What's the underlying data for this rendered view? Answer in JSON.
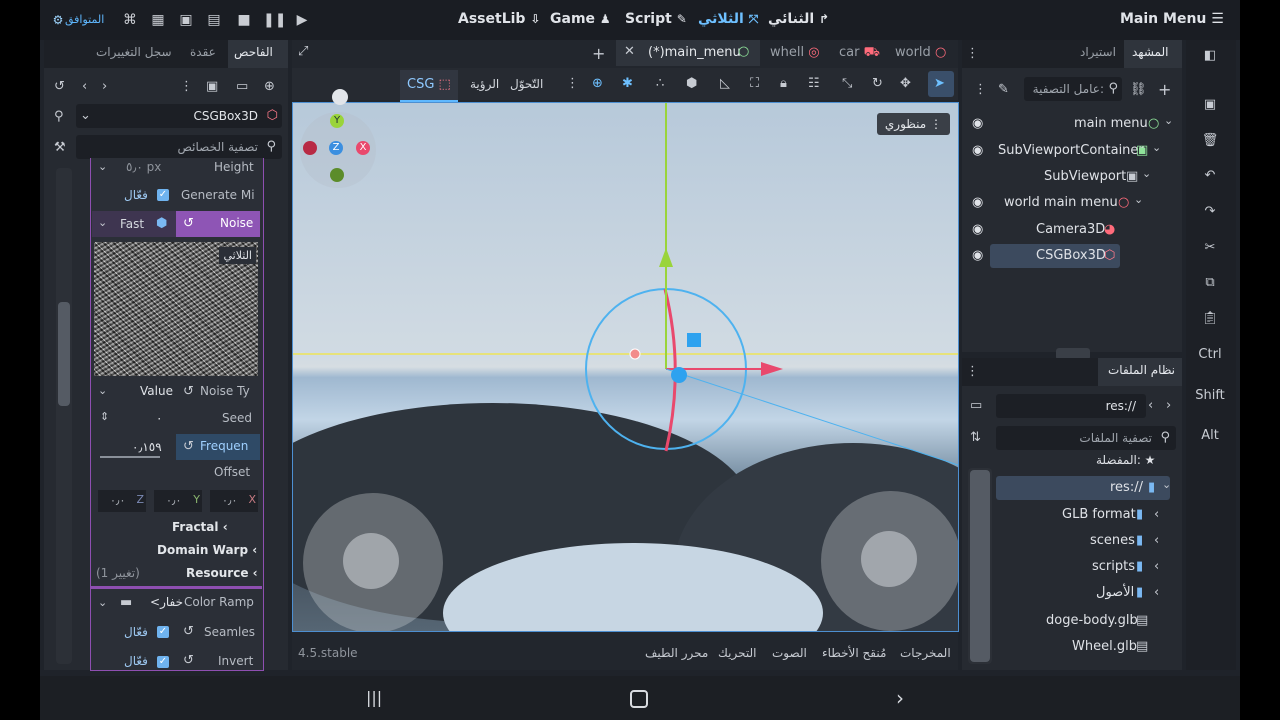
{
  "topbar": {
    "menu_title": "Main Menu",
    "mode_2d": "الثنائي",
    "mode_3d": "الثلاثي",
    "mode_script": "Script",
    "mode_game": "Game",
    "mode_assetlib": "AssetLib",
    "renderer": "المتوافق"
  },
  "scene_dock": {
    "tab_scene": "المشهد",
    "tab_import": "استيراد",
    "filter_placeholder": "عامل التصفية:",
    "nodes": [
      {
        "name": "main menu",
        "icon": "circle-node-icon"
      },
      {
        "name": "SubViewportContainer",
        "icon": "container-icon"
      },
      {
        "name": "SubViewport",
        "icon": "viewport-icon"
      },
      {
        "name": "world main menu",
        "icon": "circle-node-icon"
      },
      {
        "name": "Camera3D",
        "icon": "camera-icon"
      },
      {
        "name": "CSGBox3D",
        "icon": "csg-box-icon"
      }
    ]
  },
  "filesystem": {
    "title": "نظام الملفات",
    "path": "res://",
    "filter_placeholder": "تصفية الملفات",
    "favorites": "المفضلة:",
    "items": [
      {
        "name": "res://",
        "type": "folder"
      },
      {
        "name": "GLB format",
        "type": "folder"
      },
      {
        "name": "scenes",
        "type": "folder"
      },
      {
        "name": "scripts",
        "type": "folder"
      },
      {
        "name": "الأصول",
        "type": "folder"
      },
      {
        "name": "doge-body.glb",
        "type": "file"
      },
      {
        "name": "Wheel.glb",
        "type": "file"
      }
    ]
  },
  "editor_tabs": [
    {
      "name": "(*)main_menu",
      "active": true
    },
    {
      "name": "whell"
    },
    {
      "name": "car"
    },
    {
      "name": "world"
    }
  ],
  "viewport": {
    "csg_label": "CSG",
    "view_label": "الرؤية",
    "transform_label": "التّحوّل",
    "perspective": "منظوري",
    "gizmo": {
      "y": "Y",
      "z": "Z",
      "x": "X"
    }
  },
  "inspector": {
    "tab_inspector": "الفاحص",
    "tab_node": "عقدة",
    "tab_history": "سجل التغييرات",
    "object_name": "CSGBox3D",
    "filter_placeholder": "تصفية الخصائص",
    "height_label": "Height",
    "height_value": "٥٫٠",
    "height_unit": "px",
    "generate_label": "Generate Mi",
    "generate_value": "فعّال",
    "noise_label": "Noise",
    "noise_value": "Fast",
    "preview_badge": "الثلاثي",
    "noise_type_label": "Noise Ty",
    "noise_type_value": "Value",
    "seed_label": "Seed",
    "seed_value": "٠",
    "frequency_label": "Frequen",
    "frequency_value": "٠٫١٥٩",
    "offset_label": "Offset",
    "offset_x": "٠٫٠",
    "offset_y": "٠٫٠",
    "offset_z": "٠٫٠",
    "fractal": "Fractal",
    "domain_warp": "Domain Warp",
    "resource": "Resource",
    "resource_changes": "(1 تغيير)",
    "color_ramp_label": "Color Ramp",
    "color_ramp_value": "<خفار",
    "seamless_label": "Seamles",
    "seamless_value": "فعّال",
    "invert_label": "Invert",
    "invert_value": "فعّال"
  },
  "bottom_panel": {
    "version": "4.5.stable",
    "tabs": [
      "المخرجات",
      "مُنقح الأخطاء",
      "الصوت",
      "التحريك",
      "محرر الطيف"
    ]
  },
  "side_keys": [
    "Ctrl",
    "Shift",
    "Alt"
  ]
}
